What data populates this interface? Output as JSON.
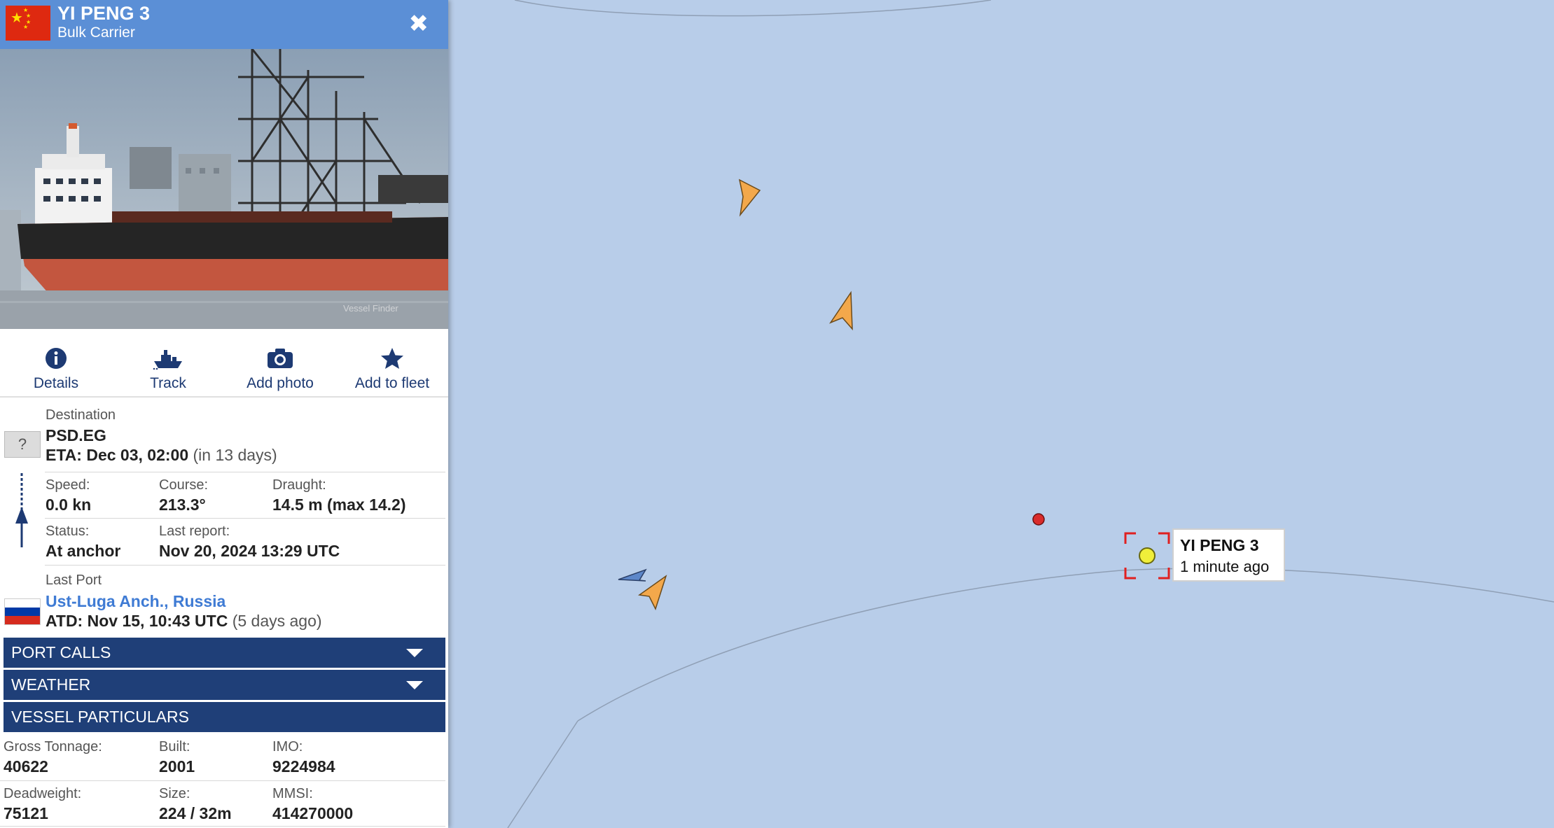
{
  "header": {
    "vessel_name": "YI PENG 3",
    "vessel_type": "Bulk Carrier",
    "flag": "China",
    "close_icon": "close-icon"
  },
  "photo": {
    "watermark": "Vessel Finder"
  },
  "actions": [
    {
      "label": "Details",
      "icon": "info-icon"
    },
    {
      "label": "Track",
      "icon": "ship-track-icon"
    },
    {
      "label": "Add photo",
      "icon": "camera-icon"
    },
    {
      "label": "Add to fleet",
      "icon": "star-icon"
    }
  ],
  "voyage": {
    "destination_caption": "Destination",
    "destination": "PSD.EG",
    "destination_flag_placeholder": "?",
    "eta": "ETA: Dec 03, 02:00",
    "eta_relative": "(in 13 days)",
    "speed_caption": "Speed:",
    "speed": "0.0 kn",
    "course_caption": "Course:",
    "course": "213.3°",
    "draught_caption": "Draught:",
    "draught": "14.5 m (max 14.2)",
    "status_caption": "Status:",
    "status": "At anchor",
    "last_report_caption": "Last report:",
    "last_report": "Nov 20, 2024 13:29 UTC",
    "last_port_caption": "Last Port",
    "last_port": "Ust-Luga Anch., Russia",
    "atd": "ATD: Nov 15, 10:43 UTC",
    "atd_relative": "(5 days ago)"
  },
  "sections": {
    "port_calls": "PORT CALLS",
    "weather": "WEATHER",
    "vessel_particulars": "VESSEL PARTICULARS"
  },
  "particulars": {
    "gross_tonnage_caption": "Gross Tonnage:",
    "gross_tonnage": "40622",
    "built_caption": "Built:",
    "built": "2001",
    "imo_caption": "IMO:",
    "imo": "9224984",
    "deadweight_caption": "Deadweight:",
    "deadweight": "75121",
    "size_caption": "Size:",
    "size": "224 / 32m",
    "mmsi_caption": "MMSI:",
    "mmsi": "414270000"
  },
  "map": {
    "selected_vessel_label": "YI PENG 3",
    "selected_vessel_updated": "1 minute ago",
    "water_color": "#b8cde9",
    "vessel_marker_color": "#f3a84b",
    "selection_color": "#e02020"
  }
}
